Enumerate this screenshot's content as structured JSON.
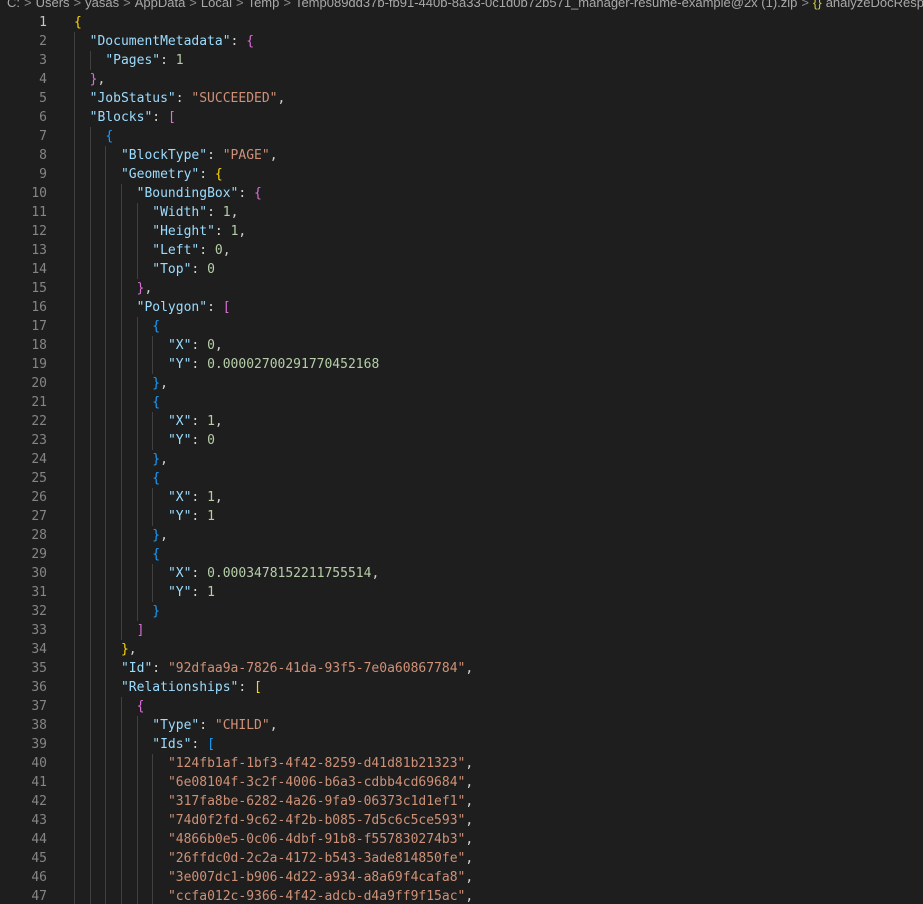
{
  "breadcrumb": {
    "items": [
      "C:",
      "Users",
      "yasas",
      "AppData",
      "Local",
      "Temp",
      "Temp089dd37b-fb91-440b-8a33-0c1d0b72b571_manager-resume-example@2x (1).zip"
    ],
    "file_icon": "{}",
    "file_name": "analyzeDocResponse.json"
  },
  "editor": {
    "active_line": 1,
    "lines": [
      {
        "n": "1",
        "d": 0,
        "t": [
          [
            "{",
            "b1"
          ]
        ]
      },
      {
        "n": "2",
        "d": 1,
        "t": [
          [
            "\"DocumentMetadata\"",
            "k"
          ],
          [
            ": ",
            "p"
          ],
          [
            "{",
            "b2"
          ]
        ]
      },
      {
        "n": "3",
        "d": 2,
        "t": [
          [
            "\"Pages\"",
            "k"
          ],
          [
            ": ",
            "p"
          ],
          [
            "1",
            "n"
          ]
        ]
      },
      {
        "n": "4",
        "d": 1,
        "t": [
          [
            "}",
            "b2"
          ],
          [
            ",",
            "p"
          ]
        ]
      },
      {
        "n": "5",
        "d": 1,
        "t": [
          [
            "\"JobStatus\"",
            "k"
          ],
          [
            ": ",
            "p"
          ],
          [
            "\"SUCCEEDED\"",
            "s"
          ],
          [
            ",",
            "p"
          ]
        ]
      },
      {
        "n": "6",
        "d": 1,
        "t": [
          [
            "\"Blocks\"",
            "k"
          ],
          [
            ": ",
            "p"
          ],
          [
            "[",
            "b2"
          ]
        ]
      },
      {
        "n": "7",
        "d": 2,
        "t": [
          [
            "{",
            "b3"
          ]
        ]
      },
      {
        "n": "8",
        "d": 3,
        "t": [
          [
            "\"BlockType\"",
            "k"
          ],
          [
            ": ",
            "p"
          ],
          [
            "\"PAGE\"",
            "s"
          ],
          [
            ",",
            "p"
          ]
        ]
      },
      {
        "n": "9",
        "d": 3,
        "t": [
          [
            "\"Geometry\"",
            "k"
          ],
          [
            ": ",
            "p"
          ],
          [
            "{",
            "b1"
          ]
        ]
      },
      {
        "n": "10",
        "d": 4,
        "t": [
          [
            "\"BoundingBox\"",
            "k"
          ],
          [
            ": ",
            "p"
          ],
          [
            "{",
            "b2"
          ]
        ]
      },
      {
        "n": "11",
        "d": 5,
        "t": [
          [
            "\"Width\"",
            "k"
          ],
          [
            ": ",
            "p"
          ],
          [
            "1",
            "n"
          ],
          [
            ",",
            "p"
          ]
        ]
      },
      {
        "n": "12",
        "d": 5,
        "t": [
          [
            "\"Height\"",
            "k"
          ],
          [
            ": ",
            "p"
          ],
          [
            "1",
            "n"
          ],
          [
            ",",
            "p"
          ]
        ]
      },
      {
        "n": "13",
        "d": 5,
        "t": [
          [
            "\"Left\"",
            "k"
          ],
          [
            ": ",
            "p"
          ],
          [
            "0",
            "n"
          ],
          [
            ",",
            "p"
          ]
        ]
      },
      {
        "n": "14",
        "d": 5,
        "t": [
          [
            "\"Top\"",
            "k"
          ],
          [
            ": ",
            "p"
          ],
          [
            "0",
            "n"
          ]
        ]
      },
      {
        "n": "15",
        "d": 4,
        "t": [
          [
            "}",
            "b2"
          ],
          [
            ",",
            "p"
          ]
        ]
      },
      {
        "n": "16",
        "d": 4,
        "t": [
          [
            "\"Polygon\"",
            "k"
          ],
          [
            ": ",
            "p"
          ],
          [
            "[",
            "b2"
          ]
        ]
      },
      {
        "n": "17",
        "d": 5,
        "t": [
          [
            "{",
            "b3"
          ]
        ]
      },
      {
        "n": "18",
        "d": 6,
        "t": [
          [
            "\"X\"",
            "k"
          ],
          [
            ": ",
            "p"
          ],
          [
            "0",
            "n"
          ],
          [
            ",",
            "p"
          ]
        ]
      },
      {
        "n": "19",
        "d": 6,
        "t": [
          [
            "\"Y\"",
            "k"
          ],
          [
            ": ",
            "p"
          ],
          [
            "0.00002700291770452168",
            "n"
          ]
        ]
      },
      {
        "n": "20",
        "d": 5,
        "t": [
          [
            "}",
            "b3"
          ],
          [
            ",",
            "p"
          ]
        ]
      },
      {
        "n": "21",
        "d": 5,
        "t": [
          [
            "{",
            "b3"
          ]
        ]
      },
      {
        "n": "22",
        "d": 6,
        "t": [
          [
            "\"X\"",
            "k"
          ],
          [
            ": ",
            "p"
          ],
          [
            "1",
            "n"
          ],
          [
            ",",
            "p"
          ]
        ]
      },
      {
        "n": "23",
        "d": 6,
        "t": [
          [
            "\"Y\"",
            "k"
          ],
          [
            ": ",
            "p"
          ],
          [
            "0",
            "n"
          ]
        ]
      },
      {
        "n": "24",
        "d": 5,
        "t": [
          [
            "}",
            "b3"
          ],
          [
            ",",
            "p"
          ]
        ]
      },
      {
        "n": "25",
        "d": 5,
        "t": [
          [
            "{",
            "b3"
          ]
        ]
      },
      {
        "n": "26",
        "d": 6,
        "t": [
          [
            "\"X\"",
            "k"
          ],
          [
            ": ",
            "p"
          ],
          [
            "1",
            "n"
          ],
          [
            ",",
            "p"
          ]
        ]
      },
      {
        "n": "27",
        "d": 6,
        "t": [
          [
            "\"Y\"",
            "k"
          ],
          [
            ": ",
            "p"
          ],
          [
            "1",
            "n"
          ]
        ]
      },
      {
        "n": "28",
        "d": 5,
        "t": [
          [
            "}",
            "b3"
          ],
          [
            ",",
            "p"
          ]
        ]
      },
      {
        "n": "29",
        "d": 5,
        "t": [
          [
            "{",
            "b3"
          ]
        ]
      },
      {
        "n": "30",
        "d": 6,
        "t": [
          [
            "\"X\"",
            "k"
          ],
          [
            ": ",
            "p"
          ],
          [
            "0.0003478152211755514",
            "n"
          ],
          [
            ",",
            "p"
          ]
        ]
      },
      {
        "n": "31",
        "d": 6,
        "t": [
          [
            "\"Y\"",
            "k"
          ],
          [
            ": ",
            "p"
          ],
          [
            "1",
            "n"
          ]
        ]
      },
      {
        "n": "32",
        "d": 5,
        "t": [
          [
            "}",
            "b3"
          ]
        ]
      },
      {
        "n": "33",
        "d": 4,
        "t": [
          [
            "]",
            "b2"
          ]
        ]
      },
      {
        "n": "34",
        "d": 3,
        "t": [
          [
            "}",
            "b1"
          ],
          [
            ",",
            "p"
          ]
        ]
      },
      {
        "n": "35",
        "d": 3,
        "t": [
          [
            "\"Id\"",
            "k"
          ],
          [
            ": ",
            "p"
          ],
          [
            "\"92dfaa9a-7826-41da-93f5-7e0a60867784\"",
            "s"
          ],
          [
            ",",
            "p"
          ]
        ]
      },
      {
        "n": "36",
        "d": 3,
        "t": [
          [
            "\"Relationships\"",
            "k"
          ],
          [
            ": ",
            "p"
          ],
          [
            "[",
            "b1"
          ]
        ]
      },
      {
        "n": "37",
        "d": 4,
        "t": [
          [
            "{",
            "b2"
          ]
        ]
      },
      {
        "n": "38",
        "d": 5,
        "t": [
          [
            "\"Type\"",
            "k"
          ],
          [
            ": ",
            "p"
          ],
          [
            "\"CHILD\"",
            "s"
          ],
          [
            ",",
            "p"
          ]
        ]
      },
      {
        "n": "39",
        "d": 5,
        "t": [
          [
            "\"Ids\"",
            "k"
          ],
          [
            ": ",
            "p"
          ],
          [
            "[",
            "b3"
          ]
        ]
      },
      {
        "n": "40",
        "d": 6,
        "t": [
          [
            "\"124fb1af-1bf3-4f42-8259-d41d81b21323\"",
            "s"
          ],
          [
            ",",
            "p"
          ]
        ]
      },
      {
        "n": "41",
        "d": 6,
        "t": [
          [
            "\"6e08104f-3c2f-4006-b6a3-cdbb4cd69684\"",
            "s"
          ],
          [
            ",",
            "p"
          ]
        ]
      },
      {
        "n": "42",
        "d": 6,
        "t": [
          [
            "\"317fa8be-6282-4a26-9fa9-06373c1d1ef1\"",
            "s"
          ],
          [
            ",",
            "p"
          ]
        ]
      },
      {
        "n": "43",
        "d": 6,
        "t": [
          [
            "\"74d0f2fd-9c62-4f2b-b085-7d5c6c5ce593\"",
            "s"
          ],
          [
            ",",
            "p"
          ]
        ]
      },
      {
        "n": "44",
        "d": 6,
        "t": [
          [
            "\"4866b0e5-0c06-4dbf-91b8-f557830274b3\"",
            "s"
          ],
          [
            ",",
            "p"
          ]
        ]
      },
      {
        "n": "45",
        "d": 6,
        "t": [
          [
            "\"26ffdc0d-2c2a-4172-b543-3ade814850fe\"",
            "s"
          ],
          [
            ",",
            "p"
          ]
        ]
      },
      {
        "n": "46",
        "d": 6,
        "t": [
          [
            "\"3e007dc1-b906-4d22-a934-a8a69f4cafa8\"",
            "s"
          ],
          [
            ",",
            "p"
          ]
        ]
      },
      {
        "n": "47",
        "d": 6,
        "t": [
          [
            "\"ccfa012c-9366-4f42-adcb-d4a9ff9f15ac\"",
            "s"
          ],
          [
            ",",
            "p"
          ]
        ]
      }
    ]
  }
}
